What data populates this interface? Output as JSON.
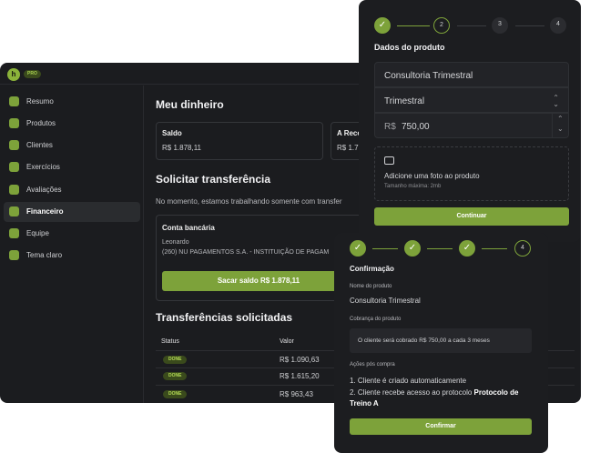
{
  "app": {
    "logo_text": "h",
    "badge": "PRO"
  },
  "sidebar": {
    "items": [
      {
        "label": "Resumo",
        "icon": "grid-icon",
        "active": false
      },
      {
        "label": "Produtos",
        "icon": "box-icon",
        "active": false
      },
      {
        "label": "Clientes",
        "icon": "users-icon",
        "active": false
      },
      {
        "label": "Exercícios",
        "icon": "dumbbell-icon",
        "active": false
      },
      {
        "label": "Avaliações",
        "icon": "clipboard-icon",
        "active": false
      },
      {
        "label": "Financeiro",
        "icon": "wallet-icon",
        "active": true
      },
      {
        "label": "Equipe",
        "icon": "team-icon",
        "active": false
      },
      {
        "label": "Tema claro",
        "icon": "sun-icon",
        "active": false
      }
    ]
  },
  "main": {
    "title": "Meu dinheiro",
    "balance": {
      "label": "Saldo",
      "value": "R$ 1.878,11"
    },
    "receivable": {
      "label": "A Rece",
      "value": "R$ 1.7"
    },
    "transfer_title": "Solicitar transferência",
    "transfer_note": "No momento, estamos trabalhando somente com transfer",
    "bank": {
      "title": "Conta bancária",
      "holder": "Leonardo",
      "account": "(260) NU PAGAMENTOS S.A. - INSTITUIÇÃO DE PAGAM",
      "withdraw_button": "Sacar saldo R$ 1.878,11"
    },
    "requested_title": "Transferências solicitadas",
    "table": {
      "headers": [
        "Status",
        "Valor"
      ],
      "rows": [
        {
          "status": "DONE",
          "value": "R$ 1.090,63"
        },
        {
          "status": "DONE",
          "value": "R$ 1.615,20"
        },
        {
          "status": "DONE",
          "value": "R$ 963,43"
        }
      ]
    }
  },
  "product_modal": {
    "steps": [
      "✓",
      "2",
      "3",
      "4"
    ],
    "title": "Dados do produto",
    "name_value": "Consultoria Trimestral",
    "period_value": "Trimestral",
    "currency": "R$",
    "price_value": "750,00",
    "photo_label": "Adicione uma foto ao produto",
    "photo_hint": "Tamanho máxima: 2mb",
    "continue_button": "Continuar"
  },
  "confirm_modal": {
    "steps": [
      "✓",
      "✓",
      "✓",
      "4"
    ],
    "title": "Confirmação",
    "name_label": "Nome do produto",
    "name_value": "Consultoria Trimestral",
    "billing_label": "Cobrança do produto",
    "billing_value": "O cliente será cobrado R$ 750,00 a cada 3 meses",
    "after_label": "Ações pós compra",
    "action_1": "1. Cliente é criado automaticamente",
    "action_2_prefix": "2. Cliente recebe acesso ao protocolo",
    "action_2_bold": "Protocolo de Treino A",
    "confirm_button": "Confirmar"
  },
  "colors": {
    "accent": "#7da23a",
    "bg": "#1b1c1f",
    "panel": "#1c1d20"
  }
}
